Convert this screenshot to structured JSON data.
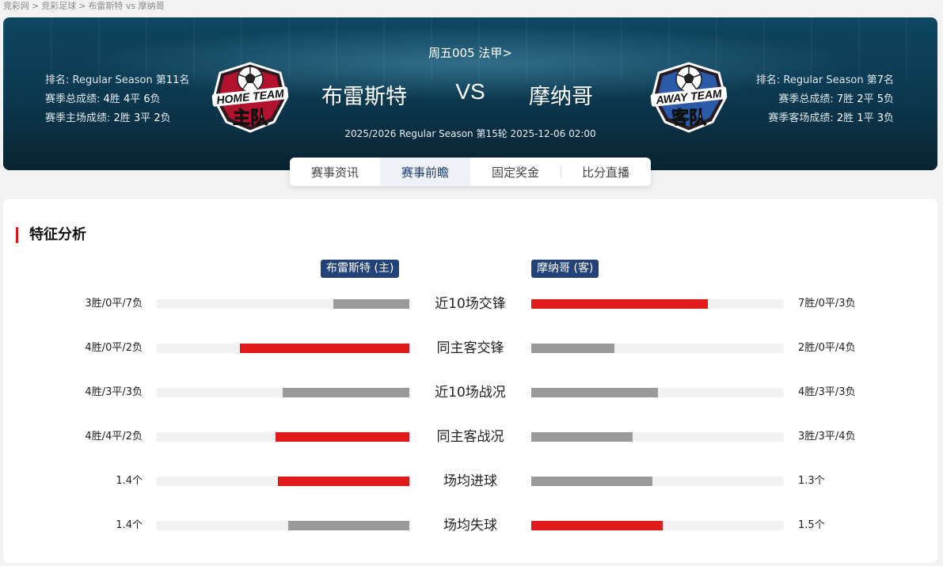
{
  "breadcrumb": [
    "竞彩网",
    "竞彩足球",
    "布雷斯特 vs 摩纳哥"
  ],
  "colors": {
    "accent_red": "#e01b1b",
    "bar_gray": "#9b9b9b",
    "tag_blue": "#234277"
  },
  "match": {
    "meta": "周五005 法甲>",
    "home": "布雷斯特",
    "away": "摩纳哥",
    "vs": "VS",
    "subline": "2025/2026 Regular Season 第15轮 2025-12-06 02:00"
  },
  "home_stats": {
    "rank_prefix": "排名: Regular Season 第",
    "rank": "11",
    "rank_suffix": "名",
    "total_prefix": "赛季总成绩: ",
    "total_w": "4",
    "total_d": "4",
    "total_l": "6",
    "venue_prefix": "赛季主场成绩: ",
    "venue_w": "2",
    "venue_d": "3",
    "venue_l": "2"
  },
  "away_stats": {
    "rank_prefix": "排名: Regular Season 第",
    "rank": "7",
    "rank_suffix": "名",
    "total_prefix": "赛季总成绩: ",
    "total_w": "7",
    "total_d": "2",
    "total_l": "5",
    "venue_prefix": "赛季客场成绩: ",
    "venue_w": "2",
    "venue_d": "1",
    "venue_l": "3"
  },
  "units": {
    "w": "胜 ",
    "d": "平 ",
    "l": "负"
  },
  "badges": {
    "home": {
      "line1": "HOME TEAM",
      "line2": "主队",
      "icon": "soccer-ball-icon"
    },
    "away": {
      "line1": "AWAY TEAM",
      "line2": "客队",
      "icon": "soccer-ball-icon"
    }
  },
  "tabs": [
    {
      "label": "赛事资讯",
      "active": false
    },
    {
      "label": "赛事前瞻",
      "active": true
    },
    {
      "label": "固定奖金",
      "active": false
    },
    {
      "label": "比分直播",
      "active": false
    }
  ],
  "analysis": {
    "title": "特征分析",
    "home_tag": "布雷斯特 (主)",
    "away_tag": "摩纳哥 (客)",
    "rows": [
      {
        "label": "近10场交锋",
        "left_text": "3胜/0平/7负",
        "right_text": "7胜/0平/3负",
        "left_ratio": 0.3,
        "right_ratio": 0.7,
        "left_color": "gray",
        "right_color": "red"
      },
      {
        "label": "同主客交锋",
        "left_text": "4胜/0平/2负",
        "right_text": "2胜/0平/4负",
        "left_ratio": 0.67,
        "right_ratio": 0.33,
        "left_color": "red",
        "right_color": "gray"
      },
      {
        "label": "近10场战况",
        "left_text": "4胜/3平/3负",
        "right_text": "4胜/3平/3负",
        "left_ratio": 0.5,
        "right_ratio": 0.5,
        "left_color": "gray",
        "right_color": "gray"
      },
      {
        "label": "同主客战况",
        "left_text": "4胜/4平/2负",
        "right_text": "3胜/3平/4负",
        "left_ratio": 0.53,
        "right_ratio": 0.4,
        "left_color": "red",
        "right_color": "gray"
      },
      {
        "label": "场均进球",
        "left_text": "1.4个",
        "right_text": "1.3个",
        "left_ratio": 0.52,
        "right_ratio": 0.48,
        "left_color": "red",
        "right_color": "gray"
      },
      {
        "label": "场均失球",
        "left_text": "1.4个",
        "right_text": "1.5个",
        "left_ratio": 0.48,
        "right_ratio": 0.52,
        "left_color": "gray",
        "right_color": "red"
      }
    ]
  }
}
